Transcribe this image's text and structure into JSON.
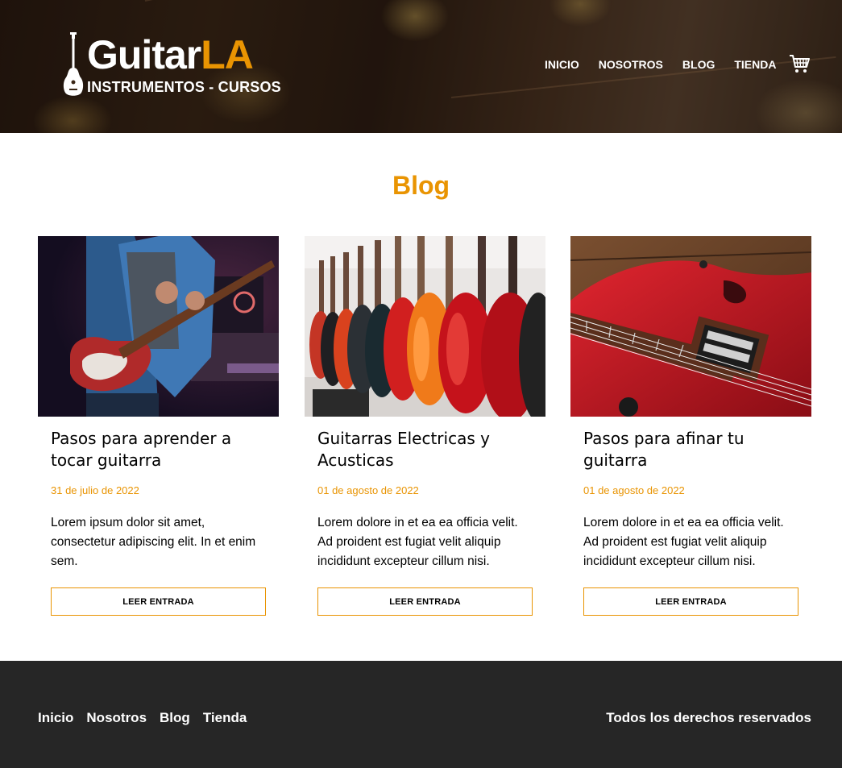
{
  "header": {
    "logo": {
      "brand_main": "Guitar",
      "brand_accent": "LA",
      "tagline": "INSTRUMENTOS - CURSOS"
    },
    "nav": [
      {
        "label": "INICIO"
      },
      {
        "label": "NOSOTROS"
      },
      {
        "label": "BLOG"
      },
      {
        "label": "TIENDA"
      }
    ],
    "cart_icon": "shopping-cart-icon"
  },
  "main": {
    "title": "Blog",
    "posts": [
      {
        "title": "Pasos para aprender a tocar guitarra",
        "date": "31 de julio de 2022",
        "excerpt": "Lorem ipsum dolor sit amet, consectetur adipiscing elit. In et enim sem.",
        "button": "LEER ENTRADA",
        "image": "guitarist-playing-red-electric-guitar"
      },
      {
        "title": "Guitarras Electricas y Acusticas",
        "date": "01 de agosto de 2022",
        "excerpt": "Lorem dolore in et ea ea officia velit. Ad proident est fugiat velit aliquip incididunt excepteur cillum nisi.",
        "button": "LEER ENTRADA",
        "image": "row-of-guitars-in-store"
      },
      {
        "title": "Pasos para afinar tu guitarra",
        "date": "01 de agosto de 2022",
        "excerpt": "Lorem dolore in et ea ea officia velit. Ad proident est fugiat velit aliquip incididunt excepteur cillum nisi.",
        "button": "LEER ENTRADA",
        "image": "red-electric-guitar-closeup"
      }
    ]
  },
  "footer": {
    "nav": [
      {
        "label": "Inicio"
      },
      {
        "label": "Nosotros"
      },
      {
        "label": "Blog"
      },
      {
        "label": "Tienda"
      }
    ],
    "copyright": "Todos los derechos reservados"
  },
  "colors": {
    "accent": "#e99402",
    "footer_bg": "#262626",
    "text": "#000000",
    "white": "#ffffff"
  }
}
